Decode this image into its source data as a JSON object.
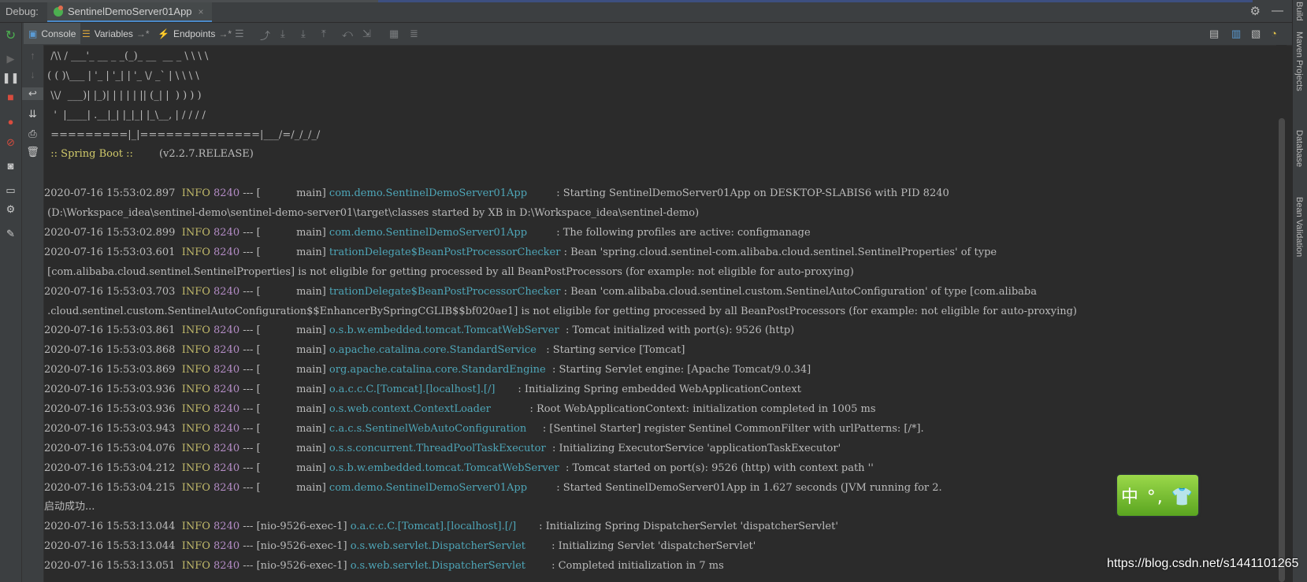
{
  "titlebar": {
    "debug_label": "Debug:",
    "tab_title": "SentinelDemoServer01App",
    "tab_close": "×",
    "settings_glyph": "⚙",
    "minimize_glyph": "—"
  },
  "toolbar": {
    "console_label": "Console",
    "variables_label": "Variables",
    "variables_suffix": "→*",
    "endpoints_label": "Endpoints",
    "endpoints_suffix": "→*"
  },
  "right_strip": {
    "build": "Build",
    "maven": "Maven Projects",
    "database": "Database",
    "bean_validation": "Bean Validation"
  },
  "banner": [
    "  /\\\\ / ___'_ __ _ _(_)_ __  __ _ \\ \\ \\ \\",
    " ( ( )\\___ | '_ | '_| | '_ \\/ _` | \\ \\ \\ \\",
    "  \\\\/  ___)| |_)| | | | | || (_| |  ) ) ) )",
    "   '  |____| .__|_| |_|_| |_\\__, | / / / /",
    "  =========|_|==============|___/=/_/_/_/"
  ],
  "spring_boot": {
    "label": "  :: Spring Boot ::",
    "version": "        (v2.2.7.RELEASE)"
  },
  "log": [
    {
      "ts": "2020-07-16 15:53:02.897",
      "level": "INFO",
      "pid": "8240",
      "thread": " --- [           main]",
      "logger": "com.demo.SentinelDemoServer01App        ",
      "msg": " : Starting SentinelDemoServer01App on DESKTOP-SLABIS6 with PID 8240"
    },
    {
      "text": " (D:\\Workspace_idea\\sentinel-demo\\sentinel-demo-server01\\target\\classes started by XB in D:\\Workspace_idea\\sentinel-demo)"
    },
    {
      "ts": "2020-07-16 15:53:02.899",
      "level": "INFO",
      "pid": "8240",
      "thread": " --- [           main]",
      "logger": "com.demo.SentinelDemoServer01App        ",
      "msg": " : The following profiles are active: configmanage"
    },
    {
      "ts": "2020-07-16 15:53:03.601",
      "level": "INFO",
      "pid": "8240",
      "thread": " --- [           main]",
      "logger": "trationDelegate$BeanPostProcessorChecker",
      "msg": " : Bean 'spring.cloud.sentinel-com.alibaba.cloud.sentinel.SentinelProperties' of type"
    },
    {
      "text": " [com.alibaba.cloud.sentinel.SentinelProperties] is not eligible for getting processed by all BeanPostProcessors (for example: not eligible for auto-proxying)"
    },
    {
      "ts": "2020-07-16 15:53:03.703",
      "level": "INFO",
      "pid": "8240",
      "thread": " --- [           main]",
      "logger": "trationDelegate$BeanPostProcessorChecker",
      "msg": " : Bean 'com.alibaba.cloud.sentinel.custom.SentinelAutoConfiguration' of type [com.alibaba"
    },
    {
      "text": " .cloud.sentinel.custom.SentinelAutoConfiguration$$EnhancerBySpringCGLIB$$bf020ae1] is not eligible for getting processed by all BeanPostProcessors (for example: not eligible for auto-proxying)"
    },
    {
      "ts": "2020-07-16 15:53:03.861",
      "level": "INFO",
      "pid": "8240",
      "thread": " --- [           main]",
      "logger": "o.s.b.w.embedded.tomcat.TomcatWebServer ",
      "msg": " : Tomcat initialized with port(s): 9526 (http)"
    },
    {
      "ts": "2020-07-16 15:53:03.868",
      "level": "INFO",
      "pid": "8240",
      "thread": " --- [           main]",
      "logger": "o.apache.catalina.core.StandardService  ",
      "msg": " : Starting service [Tomcat]"
    },
    {
      "ts": "2020-07-16 15:53:03.869",
      "level": "INFO",
      "pid": "8240",
      "thread": " --- [           main]",
      "logger": "org.apache.catalina.core.StandardEngine ",
      "msg": " : Starting Servlet engine: [Apache Tomcat/9.0.34]"
    },
    {
      "ts": "2020-07-16 15:53:03.936",
      "level": "INFO",
      "pid": "8240",
      "thread": " --- [           main]",
      "logger": "o.a.c.c.C.[Tomcat].[localhost].[/]      ",
      "msg": " : Initializing Spring embedded WebApplicationContext"
    },
    {
      "ts": "2020-07-16 15:53:03.936",
      "level": "INFO",
      "pid": "8240",
      "thread": " --- [           main]",
      "logger": "o.s.web.context.ContextLoader           ",
      "msg": " : Root WebApplicationContext: initialization completed in 1005 ms"
    },
    {
      "ts": "2020-07-16 15:53:03.943",
      "level": "INFO",
      "pid": "8240",
      "thread": " --- [           main]",
      "logger": "c.a.c.s.SentinelWebAutoConfiguration    ",
      "msg": " : [Sentinel Starter] register Sentinel CommonFilter with urlPatterns: [/*]."
    },
    {
      "ts": "2020-07-16 15:53:04.076",
      "level": "INFO",
      "pid": "8240",
      "thread": " --- [           main]",
      "logger": "o.s.s.concurrent.ThreadPoolTaskExecutor ",
      "msg": " : Initializing ExecutorService 'applicationTaskExecutor'"
    },
    {
      "ts": "2020-07-16 15:53:04.212",
      "level": "INFO",
      "pid": "8240",
      "thread": " --- [           main]",
      "logger": "o.s.b.w.embedded.tomcat.TomcatWebServer ",
      "msg": " : Tomcat started on port(s): 9526 (http) with context path ''"
    },
    {
      "ts": "2020-07-16 15:53:04.215",
      "level": "INFO",
      "pid": "8240",
      "thread": " --- [           main]",
      "logger": "com.demo.SentinelDemoServer01App        ",
      "msg": " : Started SentinelDemoServer01App in 1.627 seconds (JVM running for 2."
    },
    {
      "text": "启动成功..."
    },
    {
      "ts": "2020-07-16 15:53:13.044",
      "level": "INFO",
      "pid": "8240",
      "thread": " --- [nio-9526-exec-1]",
      "logger": "o.a.c.c.C.[Tomcat].[localhost].[/]      ",
      "msg": " : Initializing Spring DispatcherServlet 'dispatcherServlet'"
    },
    {
      "ts": "2020-07-16 15:53:13.044",
      "level": "INFO",
      "pid": "8240",
      "thread": " --- [nio-9526-exec-1]",
      "logger": "o.s.web.servlet.DispatcherServlet       ",
      "msg": " : Initializing Servlet 'dispatcherServlet'"
    },
    {
      "ts": "2020-07-16 15:53:13.051",
      "level": "INFO",
      "pid": "8240",
      "thread": " --- [nio-9526-exec-1]",
      "logger": "o.s.web.servlet.DispatcherServlet       ",
      "msg": " : Completed initialization in 7 ms"
    }
  ],
  "ime": {
    "text": "中 °, 👕"
  },
  "watermark": "https://blog.csdn.net/s1441101265"
}
